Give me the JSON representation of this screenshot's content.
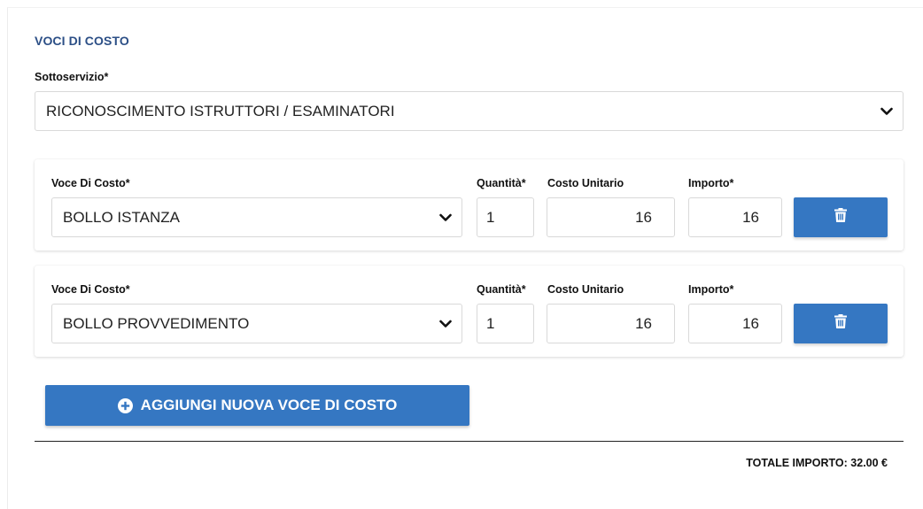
{
  "section": {
    "title": "VOCI DI COSTO"
  },
  "subservice": {
    "label": "Sottoservizio*",
    "selected": "RICONOSCIMENTO ISTRUTTORI / ESAMINATORI"
  },
  "cost_items": [
    {
      "voce_label": "Voce Di Costo*",
      "voce_value": "BOLLO ISTANZA",
      "quantity_label": "Quantità*",
      "quantity": "1",
      "unit_cost_label": "Costo Unitario",
      "unit_cost": "16",
      "amount_label": "Importo*",
      "amount": "16",
      "delete_icon": "trash-icon"
    },
    {
      "voce_label": "Voce Di Costo*",
      "voce_value": "BOLLO PROVVEDIMENTO",
      "quantity_label": "Quantità*",
      "quantity": "1",
      "unit_cost_label": "Costo Unitario",
      "unit_cost": "16",
      "amount_label": "Importo*",
      "amount": "16",
      "delete_icon": "trash-icon"
    }
  ],
  "add_button": {
    "label": "AGGIUNGI NUOVA VOCE DI COSTO",
    "icon": "plus-circle-icon"
  },
  "total": {
    "text": "TOTALE IMPORTO: 32.00 €"
  },
  "colors": {
    "accent": "#3577c2",
    "title": "#2c4f86"
  }
}
